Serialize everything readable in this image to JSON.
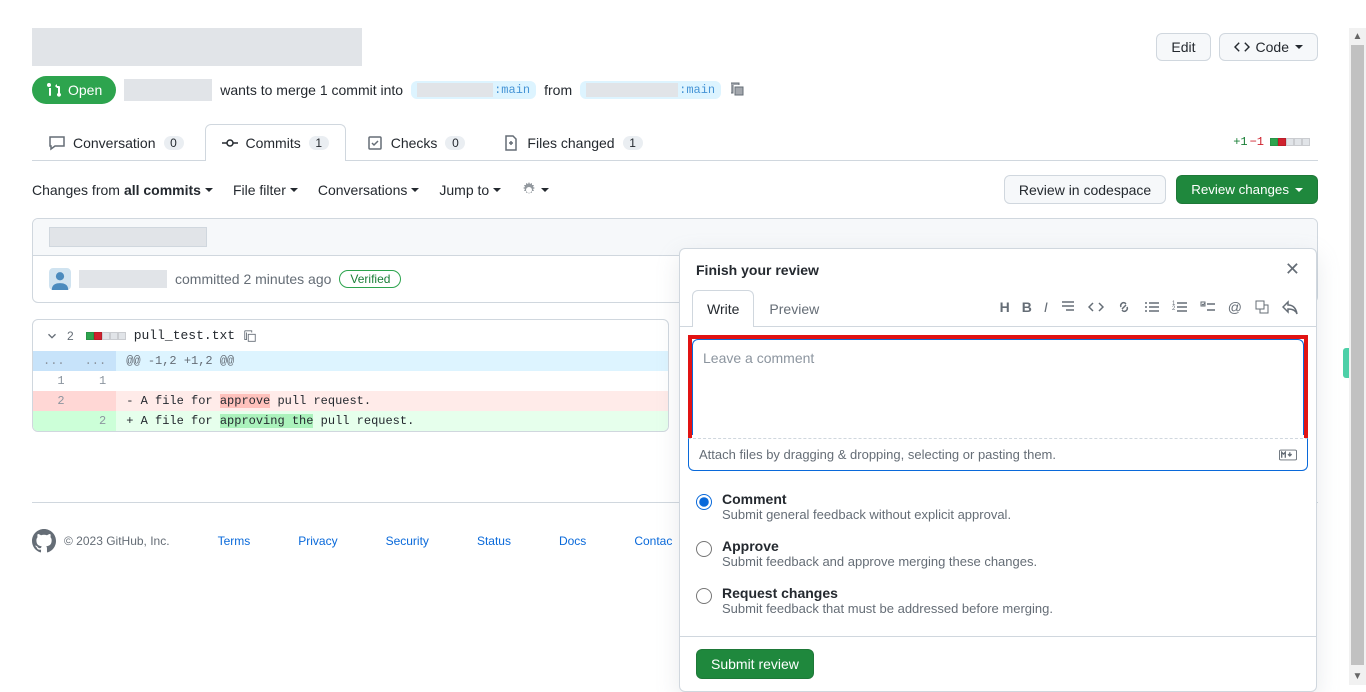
{
  "header": {
    "edit_label": "Edit",
    "code_label": "Code"
  },
  "status": {
    "label": "Open",
    "merge_text_1": "wants to merge 1 commit into",
    "branch_into": ":main",
    "merge_text_2": "from",
    "branch_from": ":main"
  },
  "tabs": {
    "conversation": {
      "label": "Conversation",
      "count": "0"
    },
    "commits": {
      "label": "Commits",
      "count": "1"
    },
    "checks": {
      "label": "Checks",
      "count": "0"
    },
    "files": {
      "label": "Files changed",
      "count": "1"
    }
  },
  "diffstat": {
    "plus": "+1",
    "minus": "−1"
  },
  "toolbar": {
    "changes_from": "Changes from",
    "all_commits": "all commits",
    "file_filter": "File filter",
    "conversations": "Conversations",
    "jump_to": "Jump to",
    "review_codespace": "Review in codespace",
    "review_changes": "Review changes"
  },
  "commit": {
    "committed": "committed 2 minutes ago",
    "verified": "Verified"
  },
  "file": {
    "changes": "2",
    "name": "pull_test.txt",
    "hunk": "@@ -1,2 +1,2 @@",
    "rows": [
      {
        "old": "1",
        "new": "1",
        "code": "",
        "cls": "ctx"
      },
      {
        "old": "2",
        "new": "",
        "code": "- A file for ",
        "hl": "approve",
        "rest": " pull request.",
        "cls": "del"
      },
      {
        "old": "",
        "new": "2",
        "code": "+ A file for ",
        "hl": "approving the",
        "rest": " pull request.",
        "cls": "add"
      }
    ]
  },
  "popover": {
    "title": "Finish your review",
    "write": "Write",
    "preview": "Preview",
    "placeholder": "Leave a comment",
    "attach": "Attach files by dragging & dropping, selecting or pasting them.",
    "options": [
      {
        "label": "Comment",
        "desc": "Submit general feedback without explicit approval.",
        "checked": true
      },
      {
        "label": "Approve",
        "desc": "Submit feedback and approve merging these changes.",
        "checked": false
      },
      {
        "label": "Request changes",
        "desc": "Submit feedback that must be addressed before merging.",
        "checked": false
      }
    ],
    "submit": "Submit review"
  },
  "footer": {
    "copyright": "© 2023 GitHub, Inc.",
    "links": [
      "Terms",
      "Privacy",
      "Security",
      "Status",
      "Docs",
      "Contac"
    ]
  }
}
